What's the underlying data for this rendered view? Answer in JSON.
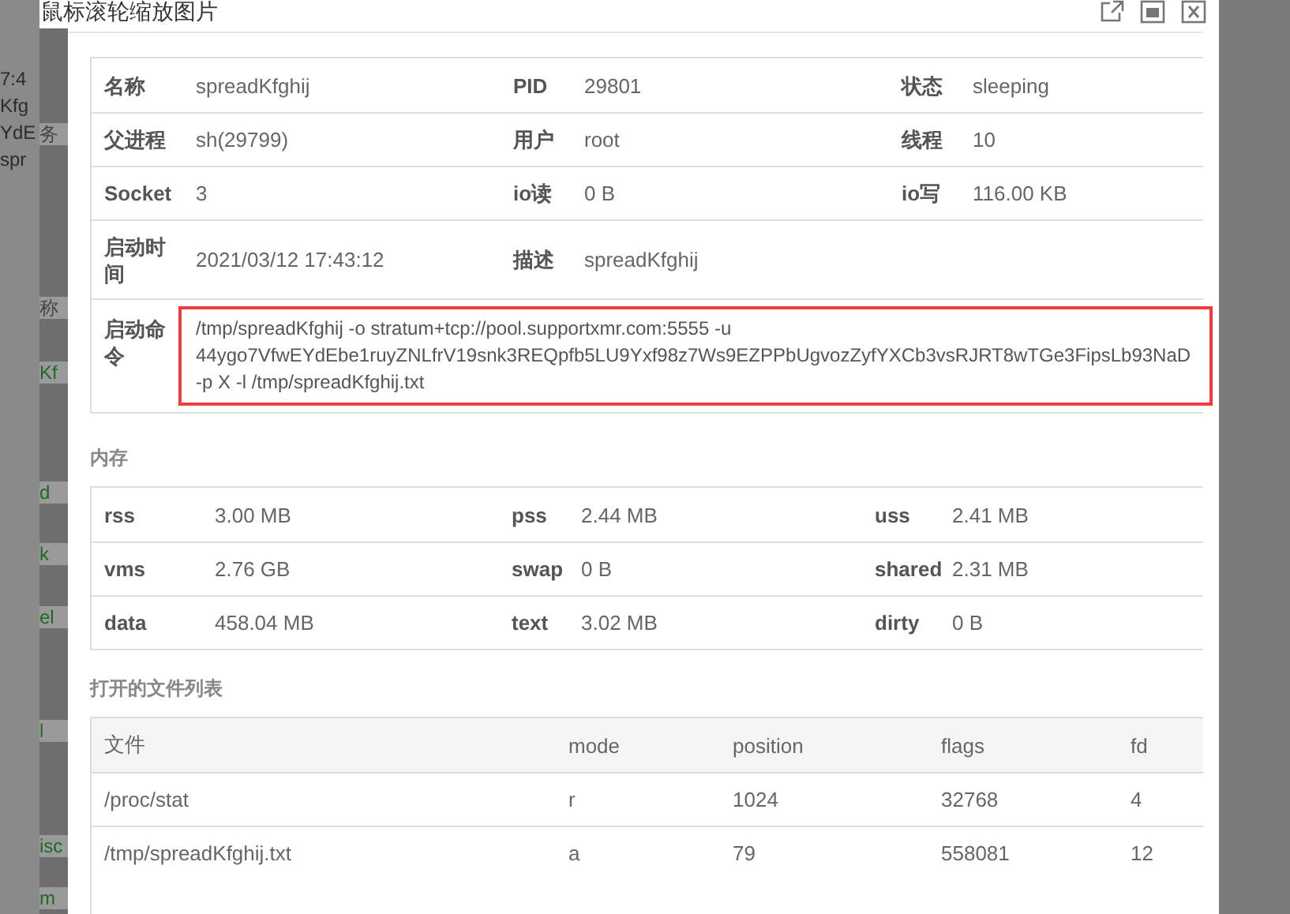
{
  "background_fragments": [
    "7:4",
    "Kfg",
    "YdE",
    "spr"
  ],
  "inner_fragments": [
    {
      "text": "务",
      "kind": "text"
    },
    {
      "text": "称",
      "kind": "text"
    },
    {
      "text": "Kf",
      "kind": "link"
    },
    {
      "text": "d",
      "kind": "link"
    },
    {
      "text": "k",
      "kind": "link"
    },
    {
      "text": "el",
      "kind": "link"
    },
    {
      "text": "l",
      "kind": "link"
    },
    {
      "text": "isc",
      "kind": "link"
    },
    {
      "text": "m",
      "kind": "link"
    }
  ],
  "window": {
    "title": "鼠标滚轮缩放图片"
  },
  "process": {
    "rows": [
      [
        {
          "label": "名称",
          "value": "spreadKfghij"
        },
        {
          "label": "PID",
          "value": "29801"
        },
        {
          "label": "状态",
          "value": "sleeping"
        }
      ],
      [
        {
          "label": "父进程",
          "value": "sh(29799)"
        },
        {
          "label": "用户",
          "value": "root"
        },
        {
          "label": "线程",
          "value": "10"
        }
      ],
      [
        {
          "label": "Socket",
          "value": "3"
        },
        {
          "label": "io读",
          "value": "0 B"
        },
        {
          "label": "io写",
          "value": "116.00 KB"
        }
      ],
      [
        {
          "label": "启动时间",
          "value": "2021/03/12 17:43:12"
        },
        {
          "label": "描述",
          "value": "spreadKfghij"
        }
      ]
    ],
    "command": {
      "label": "启动命令",
      "highlighted": true,
      "lines": [
        "/tmp/spreadKfghij -o stratum+tcp://pool.supportxmr.com:5555 -u",
        "44ygo7VfwEYdEbe1ruyZNLfrV19snk3REQpfb5LU9Yxf98z7Ws9EZPPbUgvozZyfYXCb3vsRJRT8wTGe3FipsLb93NaD",
        "-p X -l /tmp/spreadKfghij.txt"
      ]
    }
  },
  "memory": {
    "title": "内存",
    "rows": [
      [
        {
          "label": "rss",
          "value": "3.00 MB"
        },
        {
          "label": "pss",
          "value": "2.44 MB"
        },
        {
          "label": "uss",
          "value": "2.41 MB"
        }
      ],
      [
        {
          "label": "vms",
          "value": "2.76 GB"
        },
        {
          "label": "swap",
          "value": "0 B"
        },
        {
          "label": "shared",
          "value": "2.31 MB"
        }
      ],
      [
        {
          "label": "data",
          "value": "458.04 MB"
        },
        {
          "label": "text",
          "value": "3.02 MB"
        },
        {
          "label": "dirty",
          "value": "0 B"
        }
      ]
    ]
  },
  "files": {
    "title": "打开的文件列表",
    "columns": [
      "文件",
      "mode",
      "position",
      "flags",
      "fd"
    ],
    "rows": [
      [
        "/proc/stat",
        "r",
        "1024",
        "32768",
        "4"
      ],
      [
        "/tmp/spreadKfghij.txt",
        "a",
        "79",
        "558081",
        "12"
      ]
    ]
  }
}
